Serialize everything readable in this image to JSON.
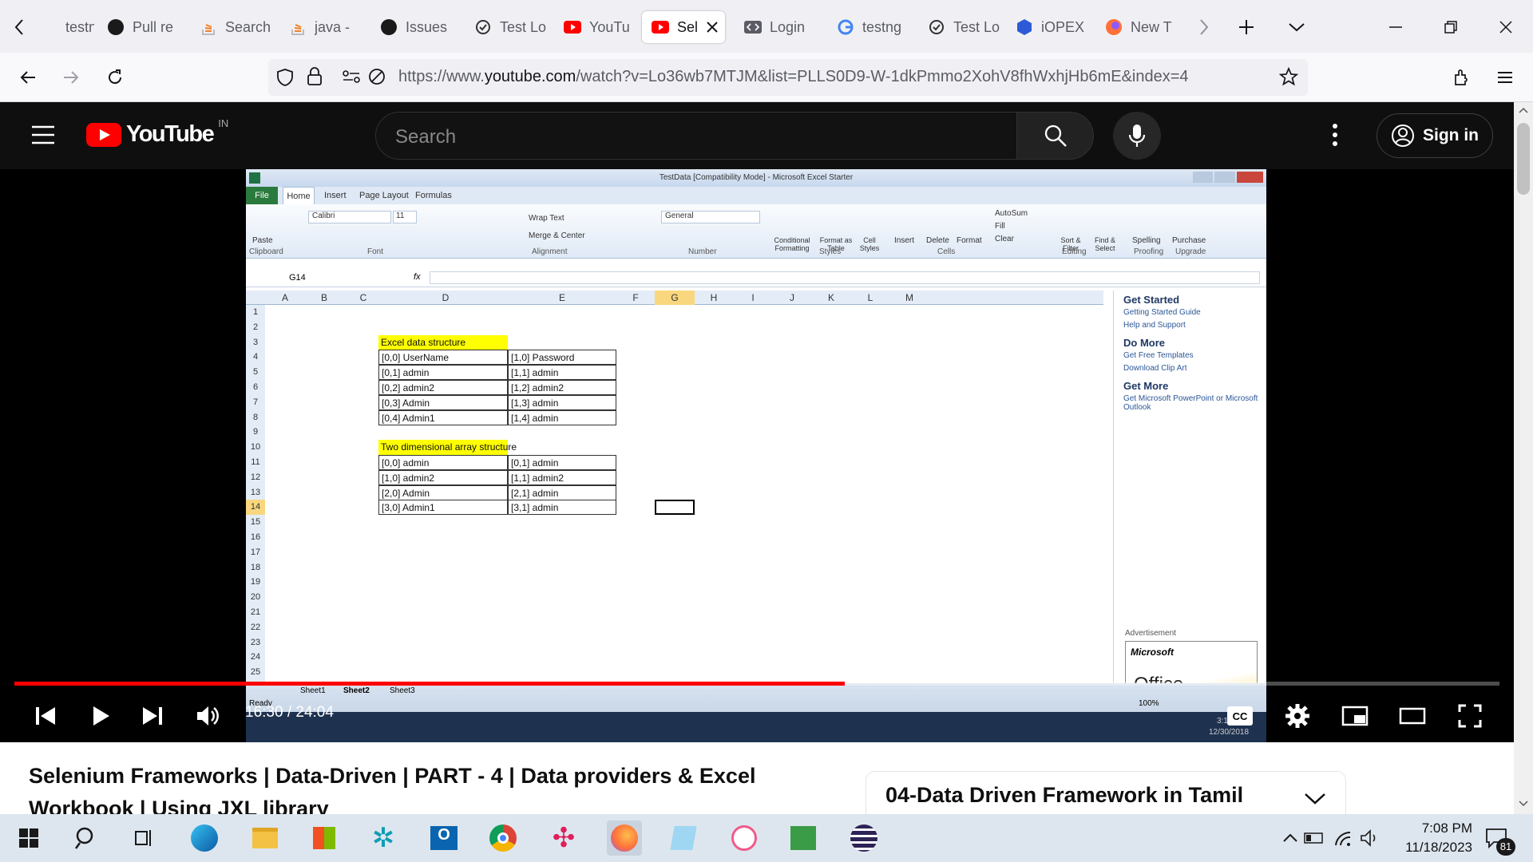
{
  "browser": {
    "tabs": [
      {
        "label": "testng",
        "icon": "test-tube-icon"
      },
      {
        "label": "Pull re",
        "icon": "github-icon"
      },
      {
        "label": "Search",
        "icon": "stackoverflow-icon"
      },
      {
        "label": "java -",
        "icon": "stackoverflow-icon"
      },
      {
        "label": "Issues",
        "icon": "github-icon"
      },
      {
        "label": "Test Lo",
        "icon": "testng-icon"
      },
      {
        "label": "YouTu",
        "icon": "youtube-icon"
      },
      {
        "label": "Sel",
        "icon": "youtube-icon",
        "active": true
      },
      {
        "label": "Login",
        "icon": "code-icon"
      },
      {
        "label": "testng",
        "icon": "google-icon"
      },
      {
        "label": "Test Lo",
        "icon": "testng-icon"
      },
      {
        "label": "iOPEX",
        "icon": "iopex-icon"
      },
      {
        "label": "New T",
        "icon": "firefox-icon"
      }
    ],
    "url_prefix": "https://www.",
    "url_domain": "youtube.com",
    "url_rest": "/watch?v=Lo36wb7MTJM&list=PLLS0D9-W-1dkPmmo2XohV8fhWxhjHb6mE&index=4"
  },
  "youtube": {
    "logo_text": "YouTube",
    "region": "IN",
    "search_placeholder": "Search",
    "signin_label": "Sign in",
    "time": "16:30 / 24:04",
    "progress_fraction": 0.559,
    "video_title": "Selenium Frameworks | Data-Driven | PART - 4 | Data providers & Excel Workbook | Using JXL library",
    "playlist_title": "04-Data Driven Framework in Tamil",
    "cc": "CC"
  },
  "excel": {
    "window_title": "TestData [Compatibility Mode] - Microsoft Excel Starter",
    "tabs": [
      "File",
      "Home",
      "Insert",
      "Page Layout",
      "Formulas"
    ],
    "font_name": "Calibri",
    "font_size": "11",
    "number_format": "General",
    "groups": [
      "Clipboard",
      "Font",
      "Alignment",
      "Number",
      "Styles",
      "Cells",
      "Editing",
      "Proofing",
      "Upgrade"
    ],
    "ribbon_buttons": [
      "Paste",
      "Wrap Text",
      "Merge & Center",
      "Conditional Formatting",
      "Format as Table",
      "Cell Styles",
      "Insert",
      "Delete",
      "Format",
      "AutoSum",
      "Fill",
      "Clear",
      "Sort & Filter",
      "Find & Select",
      "Spelling",
      "Purchase"
    ],
    "name_box": "G14",
    "fx": "fx",
    "columns": [
      "A",
      "B",
      "C",
      "D",
      "E",
      "F",
      "G",
      "H",
      "I",
      "J",
      "K",
      "L",
      "M"
    ],
    "rows": [
      "1",
      "2",
      "3",
      "4",
      "5",
      "6",
      "7",
      "8",
      "9",
      "10",
      "11",
      "12",
      "13",
      "14",
      "15",
      "16",
      "17",
      "18",
      "19",
      "20",
      "21",
      "22",
      "23",
      "24",
      "25"
    ],
    "header1": "Excel data structure",
    "table1": [
      [
        "[0,0]  UserName",
        "[1,0]  Password"
      ],
      [
        "[0,1] admin",
        "[1,1] admin"
      ],
      [
        "[0,2] admin2",
        "[1,2] admin2"
      ],
      [
        "[0,3] Admin",
        "[1,3]  admin"
      ],
      [
        "[0,4] Admin1",
        "[1,4]  admin"
      ]
    ],
    "header2": "Two dimensional array structure",
    "table2": [
      [
        "[0,0]  admin",
        "[0,1] admin"
      ],
      [
        "[1,0] admin2",
        "[1,1] admin2"
      ],
      [
        "[2,0] Admin",
        "[2,1] admin"
      ],
      [
        "[3,0] Admin1",
        "[3,1]  admin"
      ]
    ],
    "sheets": [
      "Sheet1",
      "Sheet2",
      "Sheet3"
    ],
    "status": "Ready",
    "zoom": "100%",
    "taskpane": {
      "get_started": "Get Started",
      "guide": "Getting Started Guide",
      "help": "Help and Support",
      "do_more": "Do More",
      "templates": "Get Free Templates",
      "clipart": "Download Clip Art",
      "get_more": "Get More",
      "get_more_link": "Get Microsoft PowerPoint or Microsoft Outlook",
      "ad_label": "Advertisement",
      "ad_brand": "Microsoft",
      "ad_product": "Office"
    },
    "inner_clock_time": "3:1",
    "inner_clock_date": "12/30/2018"
  },
  "taskbar": {
    "time": "7:08 PM",
    "date": "11/18/2023",
    "notifications": "81"
  },
  "colors": {
    "youtube_red": "#ff0000",
    "yt_bg": "#0f0f0f",
    "excel_yellow": "#ffff00"
  }
}
